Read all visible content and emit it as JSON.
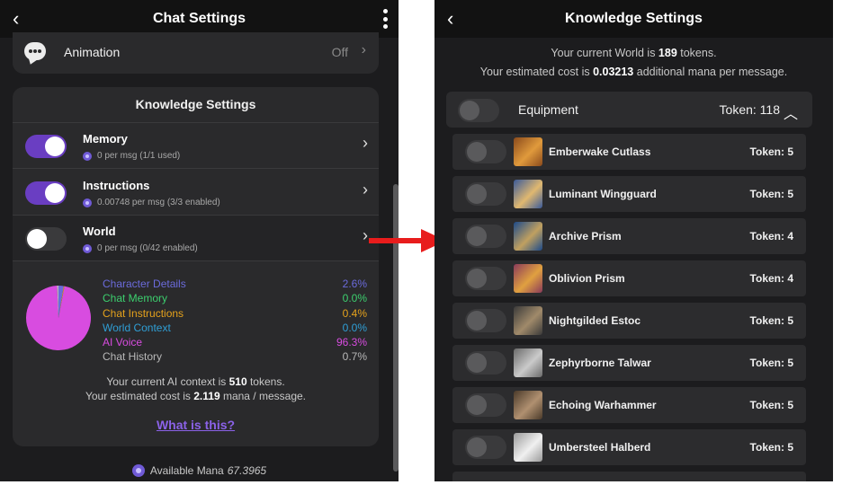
{
  "left": {
    "header_title": "Chat Settings",
    "back_glyph": "‹",
    "animation": {
      "label": "Animation",
      "value": "Off"
    },
    "knowledge": {
      "title": "Knowledge Settings",
      "rows": [
        {
          "name": "Memory",
          "sub": "0 per msg (1/1 used)",
          "enabled": true
        },
        {
          "name": "Instructions",
          "sub": "0.00748 per msg (3/3 enabled)",
          "enabled": true
        },
        {
          "name": "World",
          "sub": "0 per msg (0/42 enabled)",
          "enabled": false
        }
      ],
      "breakdown": [
        {
          "label": "Character Details",
          "value": "2.6%",
          "color": "#6b6bdc"
        },
        {
          "label": "Chat Memory",
          "value": "0.0%",
          "color": "#3ccf6e"
        },
        {
          "label": "Chat Instructions",
          "value": "0.4%",
          "color": "#e5a21c"
        },
        {
          "label": "World Context",
          "value": "0.0%",
          "color": "#2f9fd6"
        },
        {
          "label": "AI Voice",
          "value": "96.3%",
          "color": "#d84ce0"
        },
        {
          "label": "Chat History",
          "value": "0.7%",
          "color": "#b8b8b8"
        }
      ],
      "context_prefix": "Your current AI context is ",
      "context_tokens": "510",
      "context_suffix": " tokens.",
      "cost_prefix": "Your estimated cost is ",
      "cost_value": "2.119",
      "cost_suffix": " mana / message.",
      "link": "What is this?"
    },
    "available_label": "Available Mana",
    "available_value": "67.3965"
  },
  "right": {
    "header_title": "Knowledge Settings",
    "back_glyph": "‹",
    "world_prefix": "Your current World is ",
    "world_tokens": "189",
    "world_suffix": " tokens.",
    "cost_prefix": "Your estimated cost is ",
    "cost_value": "0.03213",
    "cost_suffix": " additional mana per message.",
    "category": {
      "name": "Equipment",
      "tokens": "Token: 118"
    },
    "items": [
      {
        "name": "Emberwake Cutlass",
        "tokens": "Token: 5",
        "thumb": [
          "#8a4a1c",
          "#e09a3c"
        ]
      },
      {
        "name": "Luminant Wingguard",
        "tokens": "Token: 5",
        "thumb": [
          "#3a5a9a",
          "#e0b870"
        ]
      },
      {
        "name": "Archive Prism",
        "tokens": "Token: 4",
        "thumb": [
          "#1c4a8a",
          "#c0a060"
        ]
      },
      {
        "name": "Oblivion Prism",
        "tokens": "Token: 4",
        "thumb": [
          "#8a3a5a",
          "#e0a040"
        ]
      },
      {
        "name": "Nightgilded Estoc",
        "tokens": "Token: 5",
        "thumb": [
          "#3a3a3a",
          "#a08a6a"
        ]
      },
      {
        "name": "Zephyrborne Talwar",
        "tokens": "Token: 5",
        "thumb": [
          "#6a6a6a",
          "#cacaca"
        ]
      },
      {
        "name": "Echoing Warhammer",
        "tokens": "Token: 5",
        "thumb": [
          "#4a3a2a",
          "#b09070"
        ]
      },
      {
        "name": "Umbersteel Halberd",
        "tokens": "Token: 5",
        "thumb": [
          "#9a9a9a",
          "#f0f0f0"
        ]
      }
    ]
  }
}
